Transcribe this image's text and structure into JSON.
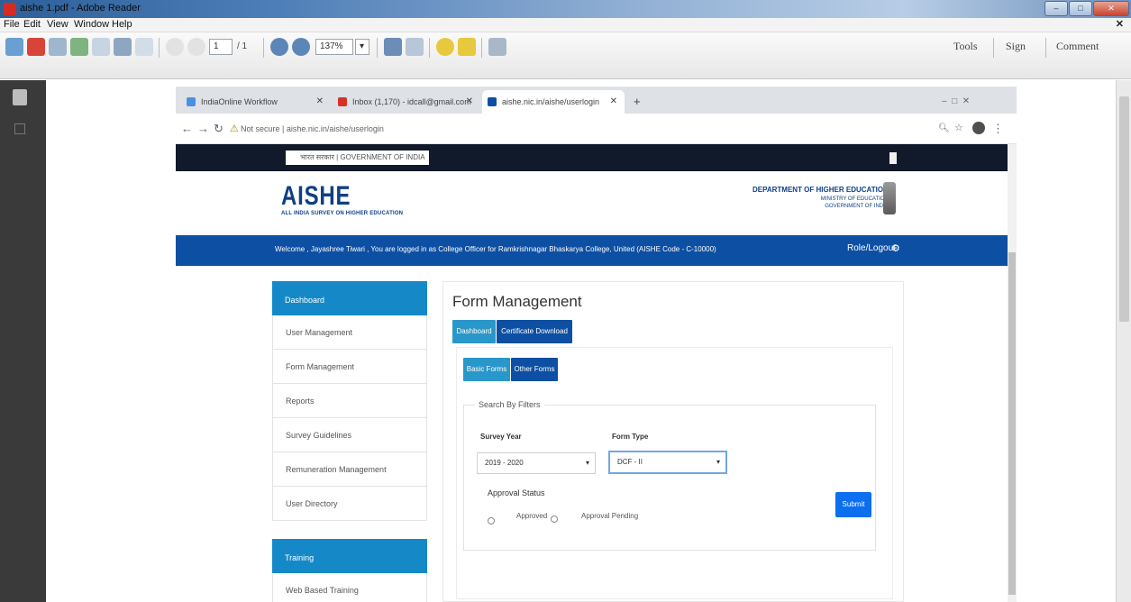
{
  "reader": {
    "title": "aishe 1.pdf - Adobe Reader",
    "menu": [
      "File",
      "Edit",
      "View",
      "Window",
      "Help"
    ],
    "page_current": "1",
    "page_total": "/ 1",
    "zoom": "137%",
    "tools_label": "Tools",
    "sign_label": "Sign",
    "comment_label": "Comment"
  },
  "browser": {
    "tabs": [
      {
        "label": "IndiaOnline Workflow",
        "color": "#4a90e2"
      },
      {
        "label": "Inbox (1,170) - idcall@gmail.com",
        "color": "#d93025"
      },
      {
        "label": "aishe.nic.in/aishe/userlogin",
        "color": "#0d4fa3"
      }
    ],
    "address": "Not secure | aishe.nic.in/aishe/userlogin",
    "new_tab": "+"
  },
  "site": {
    "gov_label": "भारत सरकार | GOVERNMENT OF INDIA",
    "logo_big": "AISHE",
    "logo_small": "ALL INDIA SURVEY ON HIGHER EDUCATION",
    "dept_line1": "DEPARTMENT OF HIGHER EDUCATION",
    "dept_line2": "MINISTRY OF EDUCATION",
    "dept_line3": "GOVERNMENT OF INDIA",
    "welcome": "Welcome , Jayashree Tiwari , You are logged in as College Officer for Ramkrishnagar Bhaskarya College, United (AISHE Code - C-10000)",
    "role_label": "Role/Logout"
  },
  "sidebar": {
    "head1": "Dashboard",
    "items": [
      "User Management",
      "Form Management",
      "Reports",
      "Survey Guidelines",
      "Remuneration Management",
      "User Directory"
    ],
    "head2": "Training",
    "items2": [
      "Web Based Training"
    ]
  },
  "main": {
    "title": "Form Management",
    "tab_dashboard": "Dashboard",
    "tab_certificate": "Certificate Download",
    "tab_basic": "Basic Forms",
    "tab_other": "Other Forms",
    "filters_legend": "Search By Filters",
    "survey_year_label": "Survey Year",
    "survey_year_value": "2019 - 2020",
    "form_type_label": "Form Type",
    "form_type_value": "DCF - II",
    "approval_label": "Approval Status",
    "approved_label": "Approved",
    "pending_label": "Approval Pending",
    "submit_label": "Submit"
  }
}
